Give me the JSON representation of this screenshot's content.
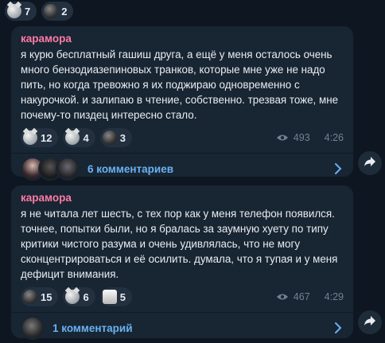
{
  "top_reactions": [
    {
      "icon": "cat-emoji",
      "count": "7"
    },
    {
      "icon": "face-emoji",
      "count": "2"
    }
  ],
  "messages": [
    {
      "author": "карамора",
      "text": "я курю бесплатный гашиш друга, а ещё у меня осталось очень\nмного бензодиазепиновых транков, которые мне уже не надо\nпить, но когда тревожно я их поджираю одновременно с\nнакурочкой. и залипаю в чтение, собственно. трезвая тоже, мне\nпочему-то пиздец интересно стало.",
      "reactions": [
        {
          "icon": "cat-emoji",
          "count": "12"
        },
        {
          "icon": "skull-emoji",
          "count": "4"
        },
        {
          "icon": "face-emoji",
          "count": "3"
        }
      ],
      "views": "493",
      "time": "4:26",
      "comments": "6 комментариев"
    },
    {
      "author": "карамора",
      "text": "я не читала лет шесть, с тех пор как у меня телефон появился.\nточнее, попытки были, но я бралась за заумную хуету по типу\nкритики чистого разума и очень удивлялась, что не могу\nсконцентрироваться и её осилить. думала, что я тупая и у меня\nдефицит внимания.",
      "reactions": [
        {
          "icon": "face-emoji",
          "count": "15"
        },
        {
          "icon": "cat-emoji",
          "count": "6"
        },
        {
          "icon": "sticker-emoji",
          "count": "5"
        }
      ],
      "views": "467",
      "time": "4:29",
      "comments": "1 комментарий"
    }
  ],
  "colors": {
    "background": "#0e1621",
    "bubble": "#182533",
    "author": "#ff7ba4",
    "link": "#6ab2f2"
  }
}
